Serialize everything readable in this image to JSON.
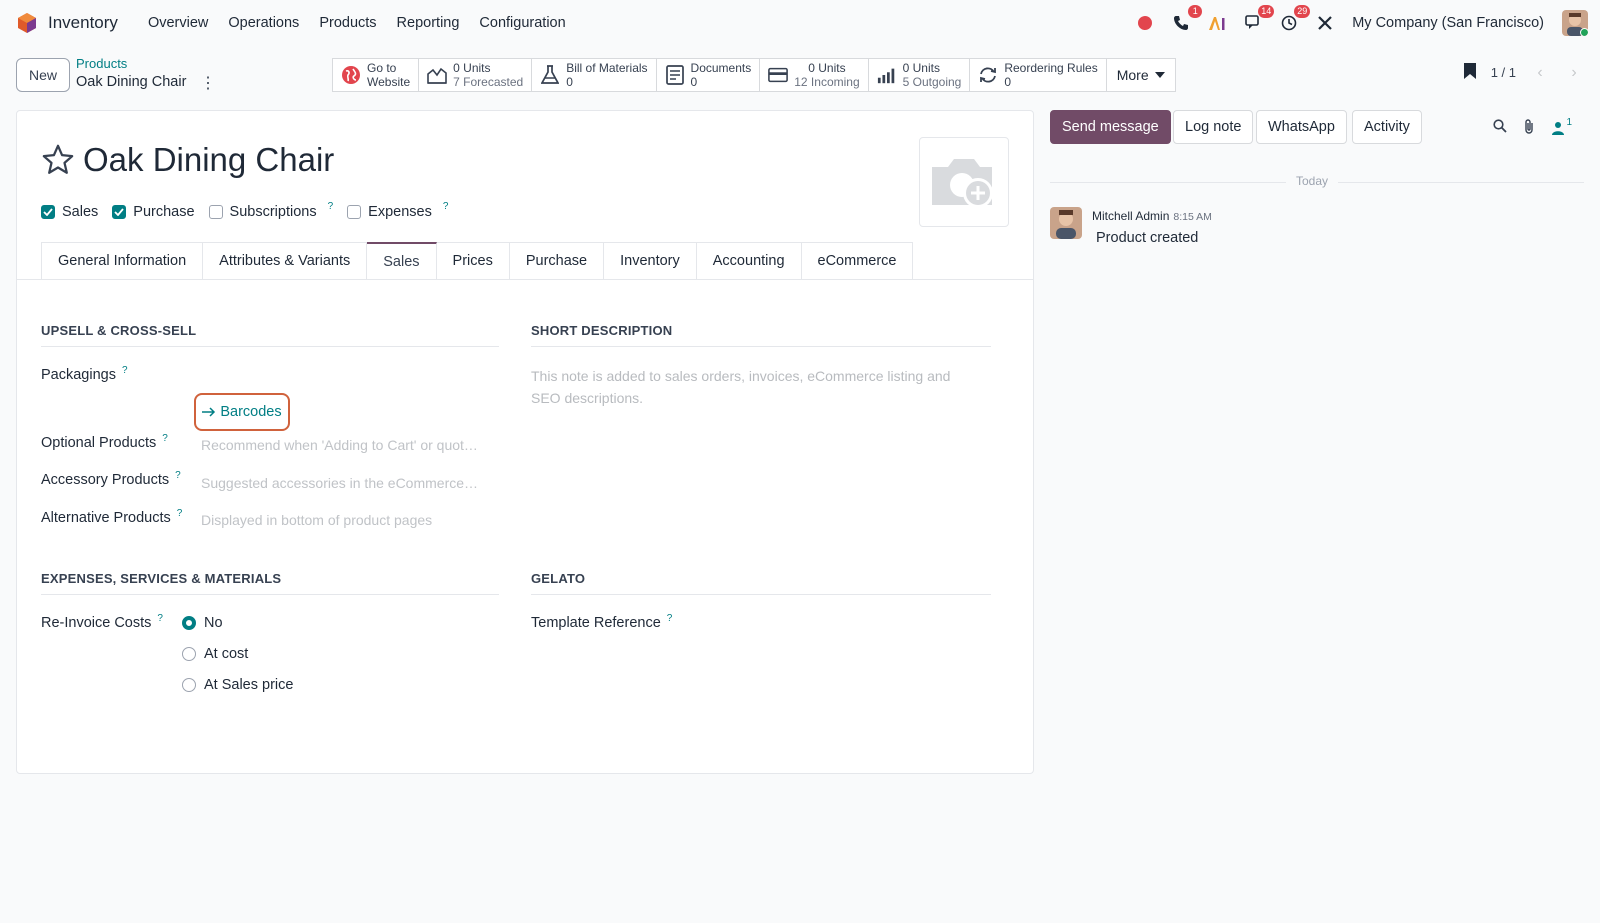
{
  "navbar": {
    "app_name": "Inventory",
    "menu": [
      "Overview",
      "Operations",
      "Products",
      "Reporting",
      "Configuration"
    ],
    "badges": {
      "phone": "1",
      "chat": "14",
      "activity": "29"
    },
    "company": "My Company (San Francisco)"
  },
  "control": {
    "new_label": "New",
    "breadcrumb_parent": "Products",
    "breadcrumb_current": "Oak Dining Chair",
    "smart_buttons": [
      {
        "line1": "Go to",
        "line2": "Website",
        "icon": "globe-icon"
      },
      {
        "line1": "0 Units",
        "line2": "7 Forecasted",
        "icon": "forecast-chart-icon"
      },
      {
        "line1": "Bill of Materials",
        "line2": "0",
        "icon": "flask-icon"
      },
      {
        "line1": "Documents",
        "line2": "0",
        "icon": "document-icon"
      },
      {
        "line1": "0 Units",
        "line2": "12 Incoming",
        "icon": "card-icon"
      },
      {
        "line1": "0 Units",
        "line2": "5 Outgoing",
        "icon": "bars-icon"
      },
      {
        "line1": "Reordering Rules",
        "line2": "0",
        "icon": "refresh-icon"
      }
    ],
    "more_label": "More",
    "pager": "1 / 1"
  },
  "form": {
    "title": "Oak Dining Chair",
    "options": [
      {
        "label": "Sales",
        "checked": true,
        "help": false
      },
      {
        "label": "Purchase",
        "checked": true,
        "help": false
      },
      {
        "label": "Subscriptions",
        "checked": false,
        "help": true
      },
      {
        "label": "Expenses",
        "checked": false,
        "help": true
      }
    ],
    "help_mark": "?",
    "tabs": [
      "General Information",
      "Attributes & Variants",
      "Sales",
      "Prices",
      "Purchase",
      "Inventory",
      "Accounting",
      "eCommerce"
    ],
    "active_tab": "Sales",
    "upsell_title": "UPSELL & CROSS-SELL",
    "packagings_label": "Packagings",
    "barcodes_label": "Barcodes",
    "optional_label": "Optional Products",
    "optional_placeholder": "Recommend when 'Adding to Cart' or quot…",
    "accessory_label": "Accessory Products",
    "accessory_placeholder": "Suggested accessories in the eCommerce…",
    "alternative_label": "Alternative Products",
    "alternative_placeholder": "Displayed in bottom of product pages",
    "short_desc_title": "SHORT DESCRIPTION",
    "short_desc_placeholder": "This note is added to sales orders, invoices, eCommerce listing and SEO descriptions.",
    "expenses_title": "EXPENSES, SERVICES & MATERIALS",
    "reinvoice_label": "Re-Invoice Costs",
    "reinvoice_options": [
      "No",
      "At cost",
      "At Sales price"
    ],
    "reinvoice_selected": "No",
    "gelato_title": "GELATO",
    "template_label": "Template Reference"
  },
  "chatter": {
    "send_message": "Send message",
    "log_note": "Log note",
    "whatsapp": "WhatsApp",
    "activity": "Activity",
    "followers_count": "1",
    "today": "Today",
    "message": {
      "author": "Mitchell Admin",
      "time": "8:15 AM",
      "body": "Product created"
    }
  },
  "colors": {
    "brand": "#714b67",
    "accent": "#017e84",
    "badge": "#e2454d",
    "highlight": "#d0623c"
  }
}
